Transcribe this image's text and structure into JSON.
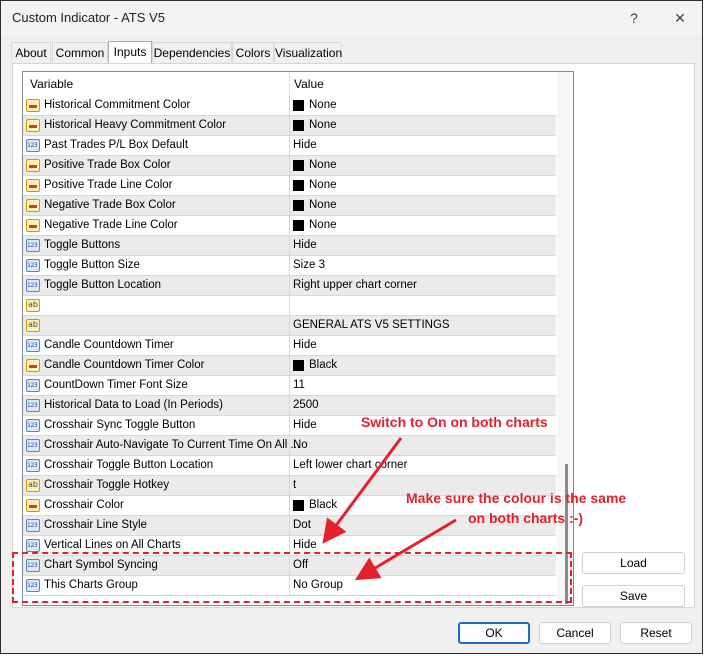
{
  "window": {
    "title": "Custom Indicator - ATS V5",
    "help_glyph": "?",
    "close_glyph": "✕"
  },
  "tabs": [
    {
      "label": "About"
    },
    {
      "label": "Common"
    },
    {
      "label": "Inputs",
      "active": true
    },
    {
      "label": "Dependencies"
    },
    {
      "label": "Colors"
    },
    {
      "label": "Visualization"
    }
  ],
  "grid": {
    "headers": {
      "variable": "Variable",
      "value": "Value"
    },
    "rows": [
      {
        "icon": "color-icon",
        "name": "Historical Commitment Color",
        "value": "None",
        "swatch": "#000000"
      },
      {
        "icon": "color-icon",
        "name": "Historical Heavy Commitment Color",
        "value": "None",
        "swatch": "#000000"
      },
      {
        "icon": "number-icon",
        "name": "Past Trades P/L Box Default",
        "value": "Hide"
      },
      {
        "icon": "color-icon",
        "name": "Positive Trade Box Color",
        "value": "None",
        "swatch": "#000000"
      },
      {
        "icon": "color-icon",
        "name": "Positive Trade Line Color",
        "value": "None",
        "swatch": "#000000"
      },
      {
        "icon": "color-icon",
        "name": "Negative Trade Box Color",
        "value": "None",
        "swatch": "#000000"
      },
      {
        "icon": "color-icon",
        "name": "Negative Trade Line Color",
        "value": "None",
        "swatch": "#000000"
      },
      {
        "icon": "number-icon",
        "name": "Toggle Buttons",
        "value": "Hide"
      },
      {
        "icon": "number-icon",
        "name": "Toggle Button Size",
        "value": "Size 3"
      },
      {
        "icon": "number-icon",
        "name": "Toggle Button Location",
        "value": "Right upper chart corner"
      },
      {
        "icon": "text-icon",
        "name": "",
        "value": ""
      },
      {
        "icon": "text-icon",
        "name": "",
        "value": "GENERAL ATS V5 SETTINGS"
      },
      {
        "icon": "number-icon",
        "name": "Candle Countdown Timer",
        "value": "Hide"
      },
      {
        "icon": "color-icon",
        "name": "Candle Countdown Timer Color",
        "value": "Black",
        "swatch": "#000000"
      },
      {
        "icon": "number-icon",
        "name": "CountDown Timer Font Size",
        "value": "11"
      },
      {
        "icon": "number-icon",
        "name": "Historical Data to Load (In Periods)",
        "value": "2500"
      },
      {
        "icon": "number-icon",
        "name": "Crosshair Sync Toggle Button",
        "value": "Hide"
      },
      {
        "icon": "number-icon",
        "name": "Crosshair Auto-Navigate To Current Time On All ...",
        "value": "No"
      },
      {
        "icon": "number-icon",
        "name": "Crosshair Toggle Button Location",
        "value": "Left lower chart corner"
      },
      {
        "icon": "text-icon",
        "name": "Crosshair Toggle Hotkey",
        "value": "t"
      },
      {
        "icon": "color-icon",
        "name": "Crosshair Color",
        "value": "Black",
        "swatch": "#000000"
      },
      {
        "icon": "number-icon",
        "name": "Crosshair Line Style",
        "value": "Dot"
      },
      {
        "icon": "number-icon",
        "name": "Vertical Lines on All Charts",
        "value": "Hide"
      },
      {
        "icon": "number-icon",
        "name": "Chart Symbol Syncing",
        "value": "Off"
      },
      {
        "icon": "number-icon",
        "name": "This Charts Group",
        "value": "No Group"
      }
    ]
  },
  "side_buttons": {
    "load": "Load",
    "save": "Save"
  },
  "footer_buttons": {
    "ok": "OK",
    "cancel": "Cancel",
    "reset": "Reset"
  },
  "annotations": {
    "switch_on": "Switch to On on both charts",
    "colour_line1": "Make sure the colour is the same",
    "colour_line2": "on both charts :-)",
    "color": "#e4202c"
  }
}
